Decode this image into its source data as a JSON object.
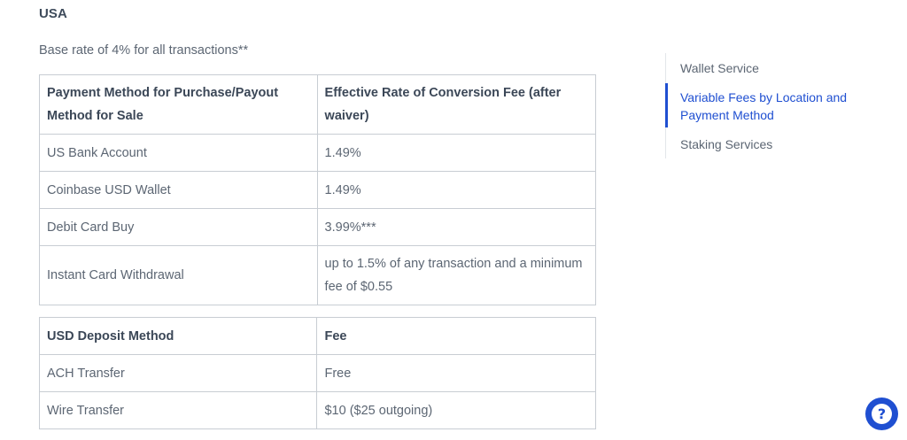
{
  "section": {
    "title": "USA",
    "base_rate": "Base rate of 4% for all transactions**"
  },
  "conversion_table": {
    "headers": [
      "Payment Method for Purchase/Payout Method for Sale",
      "Effective Rate of Conversion Fee (after waiver)"
    ],
    "rows": [
      [
        "US Bank Account",
        "1.49%"
      ],
      [
        "Coinbase USD Wallet",
        "1.49%"
      ],
      [
        "Debit Card Buy",
        "3.99%***"
      ],
      [
        "Instant Card Withdrawal",
        "up to 1.5% of any transaction and a minimum fee of $0.55"
      ]
    ]
  },
  "deposit_table": {
    "headers": [
      "USD Deposit Method",
      "Fee"
    ],
    "rows": [
      [
        "ACH Transfer",
        "Free"
      ],
      [
        "Wire Transfer",
        "$10 ($25 outgoing)"
      ]
    ]
  },
  "toc": {
    "items": [
      {
        "label": "Wallet Service",
        "active": false
      },
      {
        "label": "Variable Fees by Location and Payment Method",
        "active": true
      },
      {
        "label": "Staking Services",
        "active": false
      }
    ]
  },
  "help": {
    "icon": "question-icon",
    "glyph": "?"
  },
  "colors": {
    "accent": "#1f4fd1",
    "text": "#5c6673",
    "heading": "#3b4757",
    "border": "#c8cdd3"
  }
}
